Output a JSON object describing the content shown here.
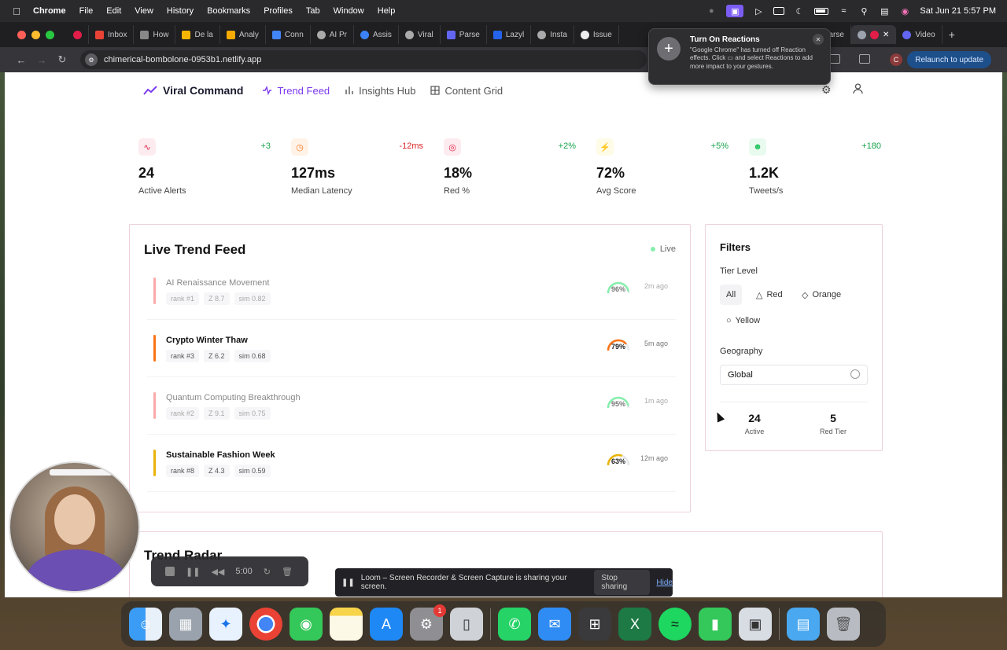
{
  "menubar": {
    "app": "Chrome",
    "items": [
      "File",
      "Edit",
      "View",
      "History",
      "Bookmarks",
      "Profiles",
      "Tab",
      "Window",
      "Help"
    ],
    "clock": "Sat Jun 21  5:57 PM"
  },
  "tabs": [
    "Inbox",
    "How",
    "De la",
    "Analy",
    "Conn",
    "AI Pr",
    "Assis",
    "Viral",
    "Parse",
    "Lazyl",
    "Insta",
    "Issue",
    "Parse",
    "Video"
  ],
  "toolbar": {
    "url": "chimerical-bombolone-0953b1.netlify.app",
    "relaunch": "Relaunch to update",
    "profile_initial": "C"
  },
  "notification": {
    "title": "Turn On Reactions",
    "body": "\"Google Chrome\" has turned off Reaction effects. Click ▭ and select Reactions to add more impact to your gestures."
  },
  "nav": {
    "brand": "Viral Command",
    "links": [
      "Trend Feed",
      "Insights Hub",
      "Content Grid"
    ]
  },
  "stats": [
    {
      "icon": "activity-icon",
      "delta": "+3",
      "value": "24",
      "label": "Active Alerts",
      "color": "#e11d48",
      "delta_color": "#16a34a"
    },
    {
      "icon": "clock-icon",
      "delta": "-12ms",
      "value": "127ms",
      "label": "Median Latency",
      "color": "#f97316",
      "delta_color": "#dc2626"
    },
    {
      "icon": "target-icon",
      "delta": "+2%",
      "value": "18%",
      "label": "Red %",
      "color": "#e11d48",
      "delta_color": "#16a34a"
    },
    {
      "icon": "zap-icon",
      "delta": "+5%",
      "value": "72%",
      "label": "Avg Score",
      "color": "#eab308",
      "delta_color": "#16a34a"
    },
    {
      "icon": "users-icon",
      "delta": "+180",
      "value": "1.2K",
      "label": "Tweets/s",
      "color": "#22c55e",
      "delta_color": "#16a34a"
    }
  ],
  "feed": {
    "title": "Live Trend Feed",
    "live_label": "Live",
    "items": [
      {
        "title": "AI Renaissance Movement",
        "rank": "rank #1",
        "z": "Z 8.7",
        "sim": "sim 0.82",
        "score": "96%",
        "score_value": 0.96,
        "ago": "2m ago",
        "color": "#f87171",
        "dim": true
      },
      {
        "title": "Crypto Winter Thaw",
        "rank": "rank #3",
        "z": "Z 6.2",
        "sim": "sim 0.68",
        "score": "79%",
        "score_value": 0.79,
        "ago": "5m ago",
        "color": "#f97316",
        "dim": false
      },
      {
        "title": "Quantum Computing Breakthrough",
        "rank": "rank #2",
        "z": "Z 9.1",
        "sim": "sim 0.75",
        "score": "95%",
        "score_value": 0.95,
        "ago": "1m ago",
        "color": "#f87171",
        "dim": true
      },
      {
        "title": "Sustainable Fashion Week",
        "rank": "rank #8",
        "z": "Z 4.3",
        "sim": "sim 0.59",
        "score": "63%",
        "score_value": 0.63,
        "ago": "12m ago",
        "color": "#eab308",
        "dim": false
      }
    ]
  },
  "filters": {
    "title": "Filters",
    "tier_label": "Tier Level",
    "tiers": [
      "All",
      "Red",
      "Orange",
      "Yellow"
    ],
    "geo_label": "Geography",
    "geo_value": "Global",
    "active_value": "24",
    "active_label": "Active",
    "red_value": "5",
    "red_label": "Red Tier"
  },
  "radar": {
    "title": "Trend Radar"
  },
  "loom": {
    "timer": "5:00",
    "message": "Loom – Screen Recorder & Screen Capture is sharing your screen.",
    "stop": "Stop sharing",
    "hide": "Hide"
  },
  "dock": {
    "badge": "1"
  }
}
